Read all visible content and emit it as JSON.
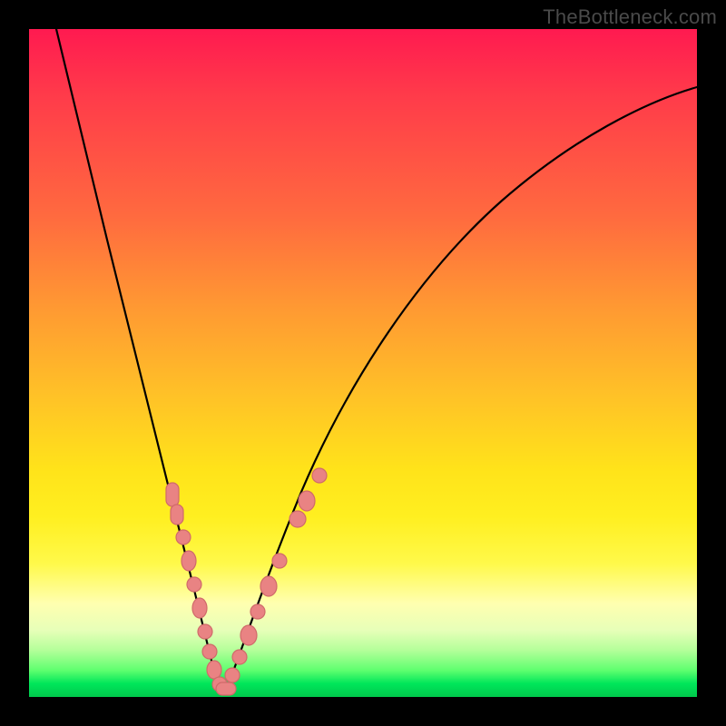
{
  "watermark": "TheBottleneck.com",
  "colors": {
    "gradient_top": "#ff1a50",
    "gradient_mid": "#ffe31a",
    "gradient_bottom": "#00c84c",
    "curve": "#000000",
    "dot_fill": "#e98383",
    "dot_stroke": "#d06a6a",
    "frame": "#000000"
  },
  "chart_data": {
    "type": "line",
    "title": "",
    "xlabel": "",
    "ylabel": "",
    "xlim": [
      0,
      100
    ],
    "ylim": [
      0,
      100
    ],
    "note": "Curve y(x) approximates bottleneck percentage; minimum at x≈28 with y≈0. Axis values are estimates (no labeled ticks in source).",
    "x": [
      4,
      8,
      12,
      16,
      20,
      23,
      25,
      27,
      28,
      29,
      31,
      34,
      38,
      44,
      52,
      62,
      74,
      88,
      100
    ],
    "y": [
      100,
      84,
      68,
      52,
      36,
      22,
      12,
      4,
      0,
      2,
      8,
      18,
      32,
      48,
      62,
      74,
      82,
      88,
      92
    ],
    "series": [
      {
        "name": "bottleneck-curve",
        "x": [
          4,
          8,
          12,
          16,
          20,
          23,
          25,
          27,
          28,
          29,
          31,
          34,
          38,
          44,
          52,
          62,
          74,
          88,
          100
        ],
        "y": [
          100,
          84,
          68,
          52,
          36,
          22,
          12,
          4,
          0,
          2,
          8,
          18,
          32,
          48,
          62,
          74,
          82,
          88,
          92
        ]
      },
      {
        "name": "highlighted-points-left-branch",
        "x": [
          21.5,
          22.4,
          23.2,
          24.0,
          24.6,
          25.3,
          26.0,
          26.7,
          27.4,
          28.1
        ],
        "y": [
          31.0,
          28.0,
          24.0,
          21.0,
          18.0,
          15.0,
          11.5,
          8.0,
          5.0,
          2.0
        ]
      },
      {
        "name": "highlighted-points-right-branch",
        "x": [
          29.2,
          30.0,
          30.8,
          31.8,
          33.0,
          34.3,
          35.7,
          37.2,
          38.8
        ],
        "y": [
          3.0,
          6.0,
          9.5,
          13.5,
          18.0,
          22.5,
          27.5,
          32.5,
          36.5
        ]
      }
    ]
  }
}
